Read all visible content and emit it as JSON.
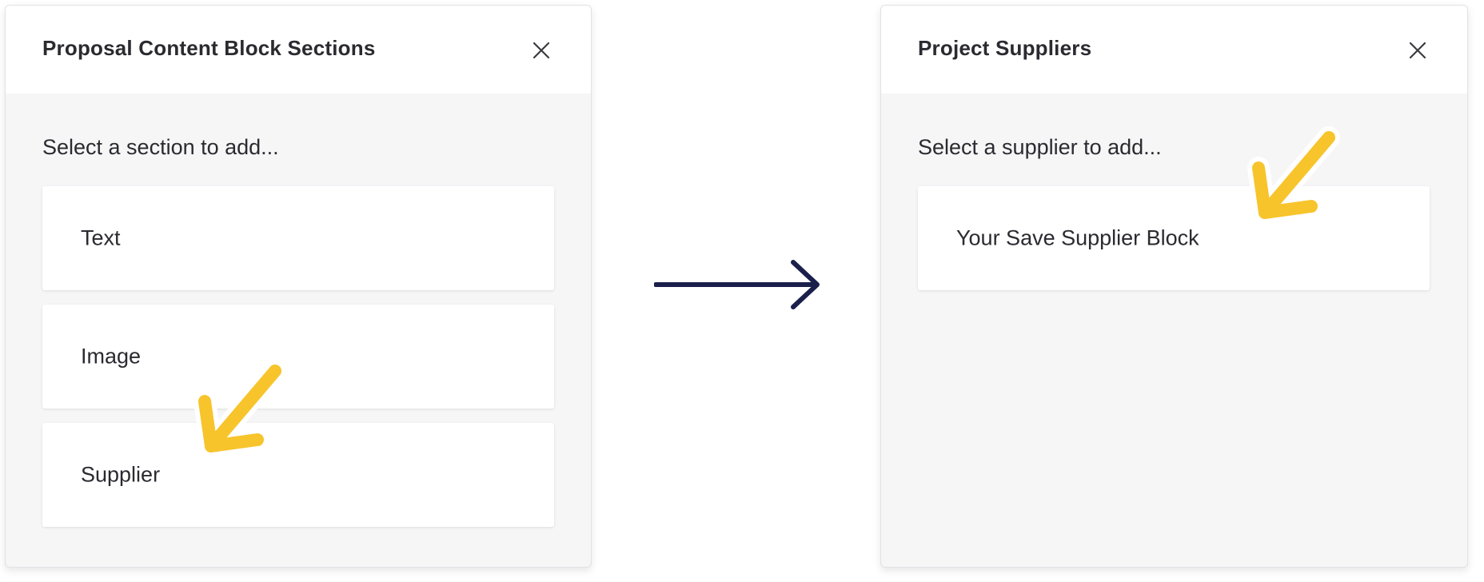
{
  "colors": {
    "panel_background": "#f6f6f7",
    "header_background": "#ffffff",
    "text": "#2a2a30",
    "flow_arrow": "#1b1f4b",
    "highlight_arrow": "#f7c42b"
  },
  "left_panel": {
    "title": "Proposal Content Block Sections",
    "close_icon": "close-icon",
    "subtitle": "Select a section to add...",
    "options": [
      {
        "label": "Text"
      },
      {
        "label": "Image"
      },
      {
        "label": "Supplier"
      }
    ]
  },
  "flow": {
    "icon": "arrow-right-icon"
  },
  "right_panel": {
    "title": "Project Suppliers",
    "close_icon": "close-icon",
    "subtitle": "Select a supplier to add...",
    "options": [
      {
        "label": "Your Save Supplier Block"
      }
    ]
  },
  "highlights": {
    "icon": "highlight-arrow-icon"
  }
}
